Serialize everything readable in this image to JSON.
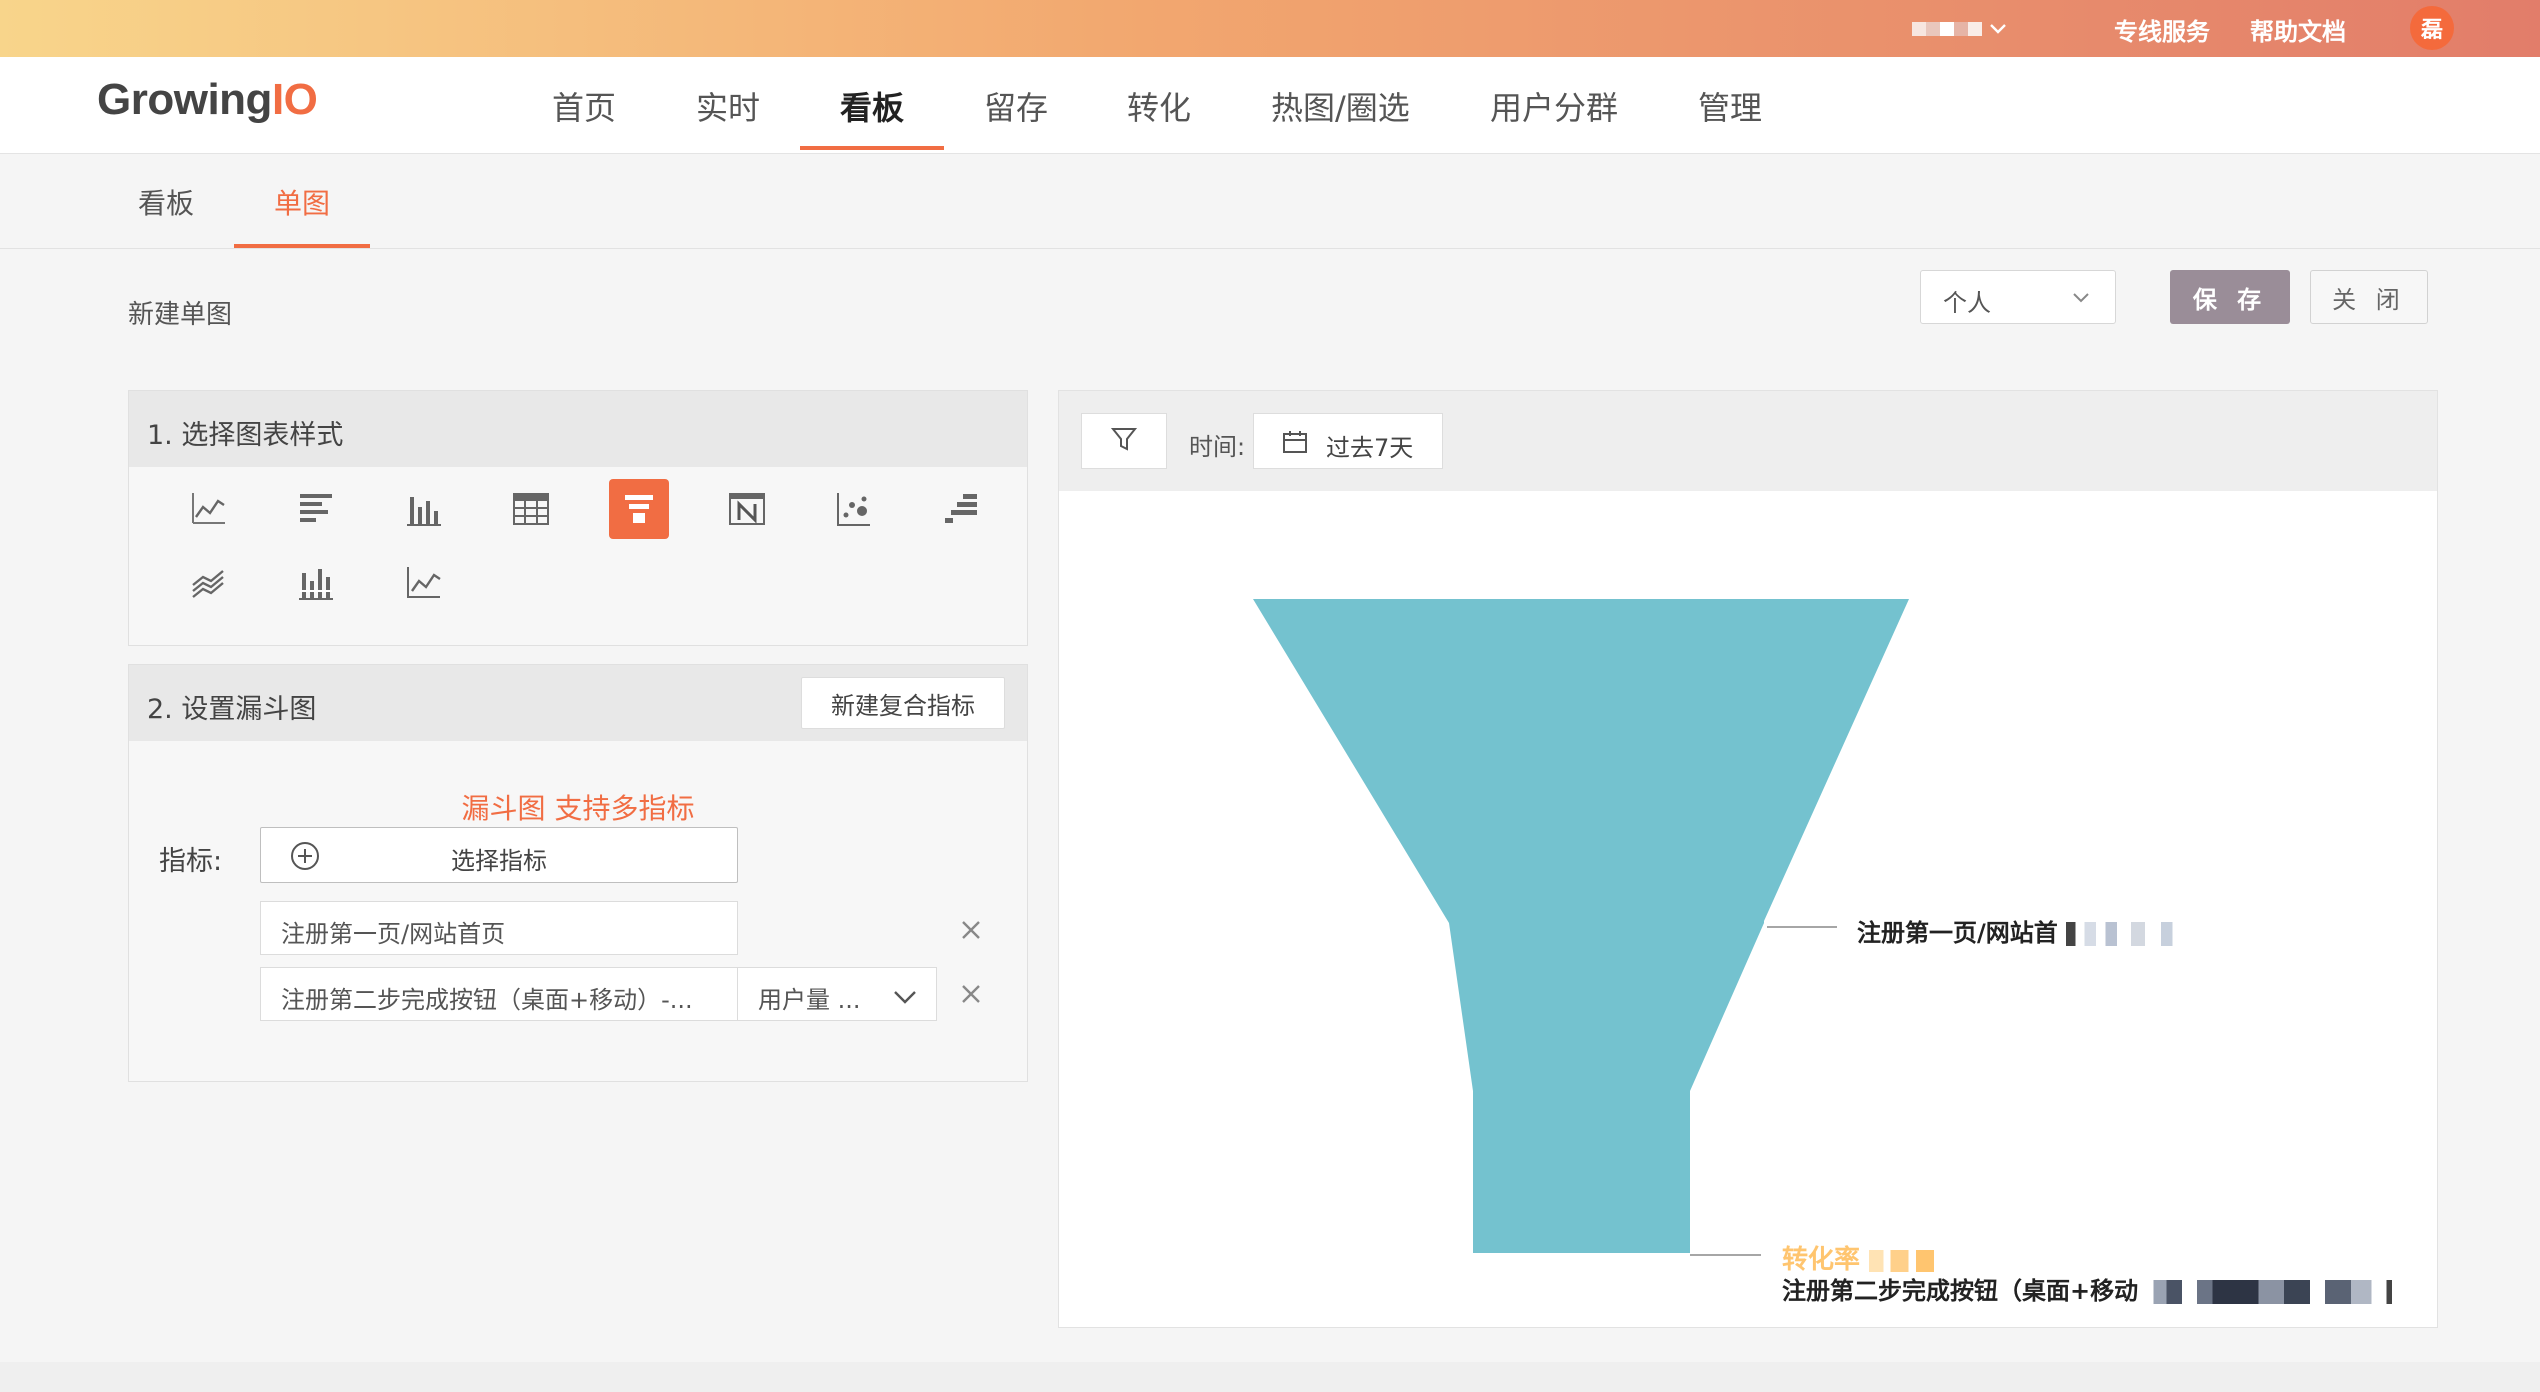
{
  "topbar": {
    "account_chevron": "chevron-down-icon",
    "dedicated_service": "专线服务",
    "help_docs": "帮助文档",
    "avatar_initial": "磊"
  },
  "brand": {
    "logo_main": "Growing",
    "logo_io": "IO",
    "accent": "#f16d43"
  },
  "nav": {
    "items": [
      {
        "label": "首页"
      },
      {
        "label": "实时"
      },
      {
        "label": "看板"
      },
      {
        "label": "留存"
      },
      {
        "label": "转化"
      },
      {
        "label": "热图/圈选"
      },
      {
        "label": "用户分群"
      },
      {
        "label": "管理"
      }
    ],
    "active": "看板"
  },
  "subnav": {
    "tabs": [
      {
        "label": "看板"
      },
      {
        "label": "单图"
      }
    ],
    "active": "单图"
  },
  "page": {
    "title": "新建单图",
    "scope": "个人",
    "save": "保 存",
    "close": "关 闭"
  },
  "step1": {
    "title": "1. 选择图表样式",
    "chart_types": [
      "line-chart-icon",
      "horizontal-bar-icon",
      "column-chart-icon",
      "table-icon",
      "funnel-icon",
      "number-card-icon",
      "scatter-icon",
      "ranking-bar-icon",
      "stacked-area-icon",
      "stacked-column-icon",
      "area-line-icon"
    ],
    "selected": "funnel-icon"
  },
  "step2": {
    "title": "2. 设置漏斗图",
    "new_composite": "新建复合指标",
    "note": "漏斗图 支持多指标",
    "metric_label": "指标:",
    "select_metric": "选择指标",
    "metrics": [
      {
        "name": "注册第一页/网站首页"
      },
      {
        "name": "注册第二步完成按钮（桌面+移动）-...",
        "aggregation": "用户量 ..."
      }
    ]
  },
  "chart": {
    "time_label": "时间:",
    "range": "过去7天",
    "fill_color": "#74c2cf",
    "rate_color": "#ffc56f"
  },
  "chart_data": {
    "type": "funnel",
    "stages": [
      {
        "name": "注册第一页/网站首"
      },
      {
        "name": "注册第二步完成按钮（桌面+移动"
      }
    ],
    "rate_label": "转化率"
  }
}
